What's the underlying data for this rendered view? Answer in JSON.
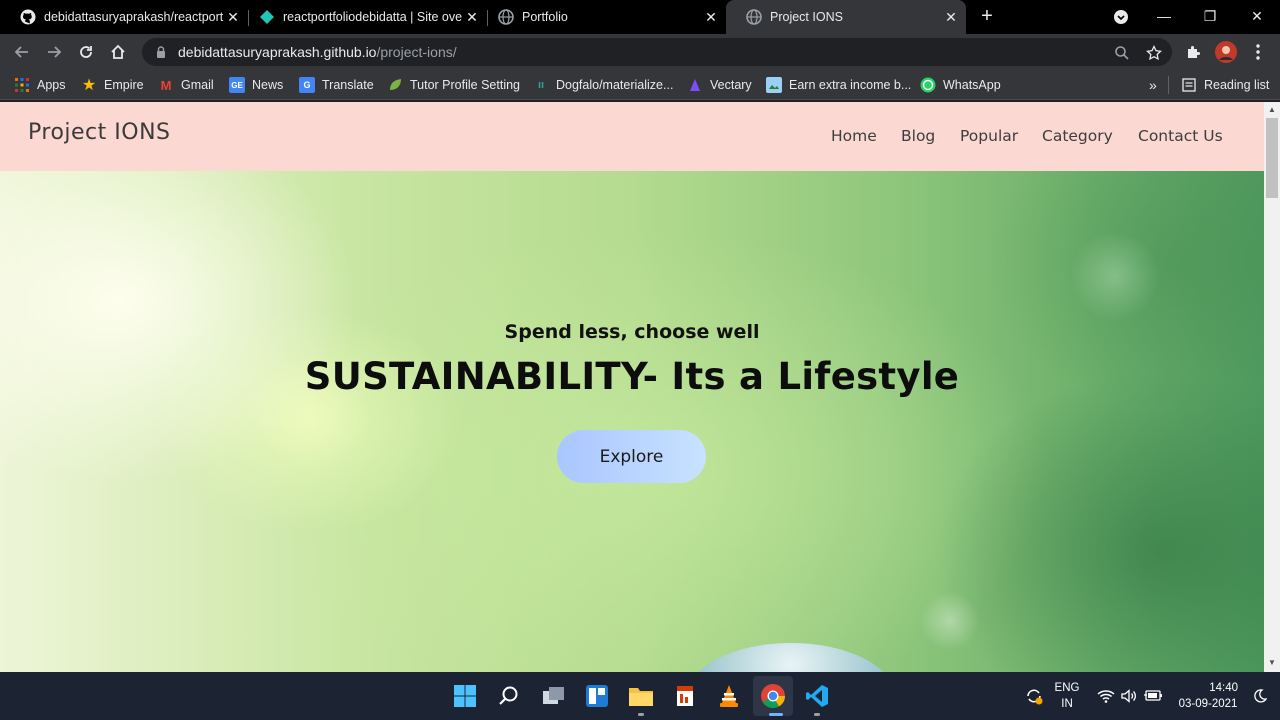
{
  "browser": {
    "tabs": [
      {
        "title": "debidattasuryaprakash/reactport",
        "icon": "github-icon"
      },
      {
        "title": "reactportfoliodebidatta | Site ove",
        "icon": "netlify-icon"
      },
      {
        "title": "Portfolio",
        "icon": "globe-icon"
      },
      {
        "title": "Project IONS",
        "icon": "globe-icon"
      }
    ],
    "url_host": "debidattasuryaprakash.github.io",
    "url_path": "/project-ions/",
    "bookmarks": [
      {
        "label": "Apps",
        "icon": "apps-grid-icon"
      },
      {
        "label": "Empire",
        "icon": "star-icon"
      },
      {
        "label": "Gmail",
        "icon": "gmail-icon"
      },
      {
        "label": "News",
        "icon": "google-news-icon"
      },
      {
        "label": "Translate",
        "icon": "google-translate-icon"
      },
      {
        "label": "Tutor Profile Setting",
        "icon": "leaf-icon"
      },
      {
        "label": "Dogfalo/materialize...",
        "icon": "materialize-icon"
      },
      {
        "label": "Vectary",
        "icon": "vectary-icon"
      },
      {
        "label": "Earn extra income b...",
        "icon": "image-icon"
      },
      {
        "label": "WhatsApp",
        "icon": "whatsapp-icon"
      }
    ],
    "overflow_label": "»",
    "reading_list": "Reading list"
  },
  "site": {
    "brand": "Project IONS",
    "menu": [
      "Home",
      "Blog",
      "Popular",
      "Category",
      "Contact Us"
    ],
    "hero_subtitle": "Spend less, choose well",
    "hero_title": "SUSTAINABILITY- Its a Lifestyle",
    "cta": "Explore"
  },
  "taskbar": {
    "lang_line1": "ENG",
    "lang_line2": "IN",
    "time": "14:40",
    "date": "03-09-2021"
  },
  "colors": {
    "nav_bg": "#fcd8d2",
    "cta_bg": "#b6d3ff",
    "taskbar_bg": "#1c2434"
  }
}
